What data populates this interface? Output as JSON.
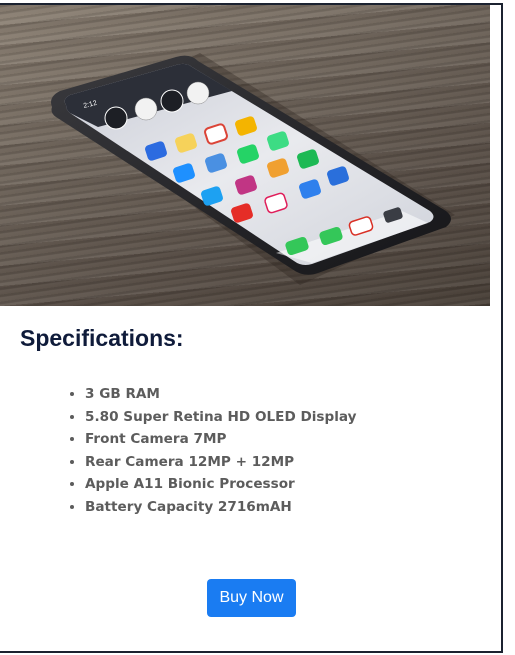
{
  "product": {
    "image_alt": "iPhone with home screen apps on a wooden table",
    "status_time": "2:12",
    "widgets": [
      "clock-widget",
      "clock-widget",
      "clock-widget",
      "clock-widget"
    ],
    "apps": [
      "files-icon",
      "notes-icon",
      "chrome-icon",
      "photos-icon",
      "maps-icon",
      "app-store-icon",
      "whatsapp-icon",
      "gmail-icon",
      "twitter-icon",
      "instagram-icon",
      "messenger-icon",
      "lens-icon",
      "youtube-icon",
      "slack-icon",
      "spotify-icon",
      "chat-icon"
    ],
    "dock": [
      "phone-icon",
      "messages-icon",
      "gmail-icon",
      "camera-icon"
    ]
  },
  "specs": {
    "title": "Specifications:",
    "items": [
      "3 GB RAM",
      "5.80 Super Retina HD OLED Display",
      "Front Camera 7MP",
      "Rear Camera 12MP + 12MP",
      "Apple A11 Bionic Processor",
      "Battery Capacity 2716mAH"
    ]
  },
  "actions": {
    "buy_label": "Buy Now"
  },
  "colors": {
    "accent": "#1a7cf2",
    "title": "#0f1b3a",
    "text": "#5c5c5c",
    "border": "#1b2230"
  }
}
